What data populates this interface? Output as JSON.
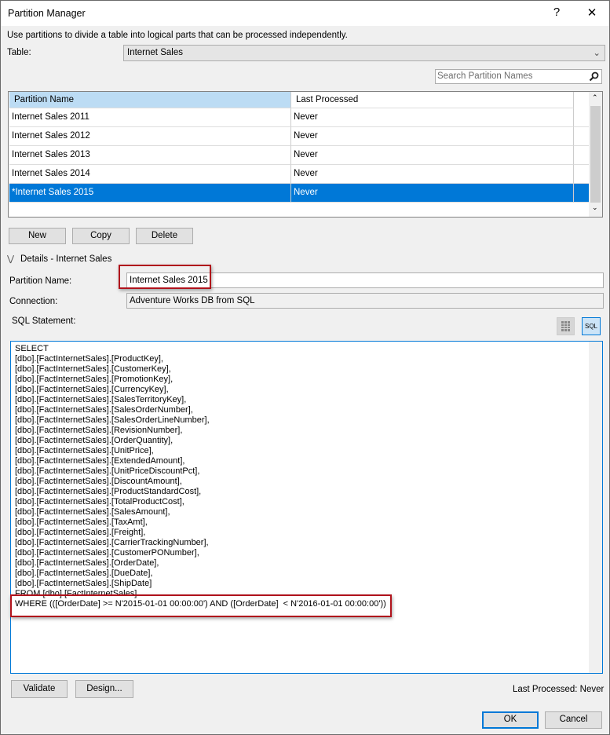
{
  "window": {
    "title": "Partition Manager",
    "help": "?",
    "close": "✕"
  },
  "description": "Use partitions to divide a table into logical parts that can be processed independently.",
  "table": {
    "label": "Table:",
    "value": "Internet Sales"
  },
  "search": {
    "placeholder": "Search Partition Names"
  },
  "grid": {
    "columns": [
      "Partition Name",
      "Last Processed"
    ],
    "rows": [
      {
        "name": "Internet Sales 2011",
        "last": "Never"
      },
      {
        "name": "Internet Sales 2012",
        "last": "Never"
      },
      {
        "name": "Internet Sales 2013",
        "last": "Never"
      },
      {
        "name": "Internet Sales 2014",
        "last": "Never"
      },
      {
        "name": "*Internet Sales 2015",
        "last": "Never",
        "selected": true
      }
    ]
  },
  "buttons": {
    "new": "New",
    "copy": "Copy",
    "delete": "Delete",
    "validate": "Validate",
    "design": "Design...",
    "ok": "OK",
    "cancel": "Cancel"
  },
  "details": {
    "heading": "Details - Internet Sales",
    "partition_name_label": "Partition Name:",
    "partition_name": "Internet Sales 2015",
    "connection_label": "Connection:",
    "connection": "Adventure Works DB from SQL",
    "sql_label": "SQL Statement:",
    "sql_toggle": "SQL"
  },
  "sql_lines": [
    "SELECT",
    "[dbo].[FactInternetSales].[ProductKey],",
    "[dbo].[FactInternetSales].[CustomerKey],",
    "[dbo].[FactInternetSales].[PromotionKey],",
    "[dbo].[FactInternetSales].[CurrencyKey],",
    "[dbo].[FactInternetSales].[SalesTerritoryKey],",
    "[dbo].[FactInternetSales].[SalesOrderNumber],",
    "[dbo].[FactInternetSales].[SalesOrderLineNumber],",
    "[dbo].[FactInternetSales].[RevisionNumber],",
    "[dbo].[FactInternetSales].[OrderQuantity],",
    "[dbo].[FactInternetSales].[UnitPrice],",
    "[dbo].[FactInternetSales].[ExtendedAmount],",
    "[dbo].[FactInternetSales].[UnitPriceDiscountPct],",
    "[dbo].[FactInternetSales].[DiscountAmount],",
    "[dbo].[FactInternetSales].[ProductStandardCost],",
    "[dbo].[FactInternetSales].[TotalProductCost],",
    "[dbo].[FactInternetSales].[SalesAmount],",
    "[dbo].[FactInternetSales].[TaxAmt],",
    "[dbo].[FactInternetSales].[Freight],",
    "[dbo].[FactInternetSales].[CarrierTrackingNumber],",
    "[dbo].[FactInternetSales].[CustomerPONumber],",
    "[dbo].[FactInternetSales].[OrderDate],",
    "[dbo].[FactInternetSales].[DueDate],",
    "[dbo].[FactInternetSales].[ShipDate]",
    "FROM [dbo].[FactInternetSales]",
    "WHERE (([OrderDate] >= N'2015-01-01 00:00:00') AND ([OrderDate]  < N'2016-01-01 00:00:00'))"
  ],
  "status": {
    "last_processed": "Last Processed: Never"
  },
  "colors": {
    "selection": "#0078d7",
    "header_selected": "#bcdcf4",
    "highlight": "#b0121b"
  }
}
